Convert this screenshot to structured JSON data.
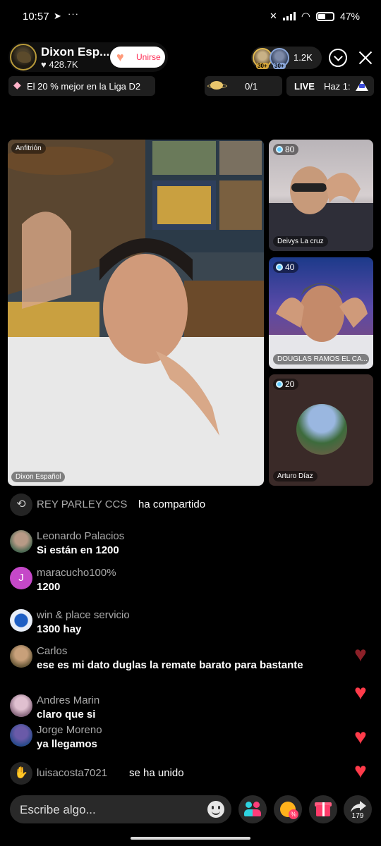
{
  "status_bar": {
    "time": "10:57",
    "telegram_icon": "telegram-icon",
    "more_dots": "···",
    "battery": "47%"
  },
  "host": {
    "name": "Dixon Esp...",
    "likes": "428.7K",
    "join_label": "Unirse"
  },
  "viewers": {
    "badge1": "30+",
    "badge2": "30+",
    "count": "1.2K"
  },
  "rank": {
    "label": "El 20 % mejor en la Liga D2"
  },
  "goal": {
    "progress": "0/1"
  },
  "live": {
    "label": "LIVE",
    "hint": "Haz 1:"
  },
  "videos": {
    "main": {
      "role_tag": "Anfitrión",
      "name": "Dixon Español"
    },
    "guests": [
      {
        "score": "80",
        "name": "Deivys La cruz"
      },
      {
        "score": "40",
        "name": "DOUGLAS RAMOS EL CA..."
      },
      {
        "score": "20",
        "name": "Arturo Díaz"
      }
    ]
  },
  "chat": {
    "share": {
      "user": "REY PARLEY CCS",
      "action": "ha compartido"
    },
    "messages": [
      {
        "user": "Leonardo Palacios",
        "text": "Si están en 1200"
      },
      {
        "user": "maracucho100%",
        "text": "1200",
        "initial": "J"
      },
      {
        "user": "win & place servicio",
        "text": "1300 hay"
      },
      {
        "user": "Carlos",
        "text": "ese es mi dato duglas la remate barato para bastante"
      },
      {
        "user": "Andres Marin",
        "text": "claro que si"
      },
      {
        "user": "Jorge Moreno",
        "text": "ya llegamos"
      }
    ],
    "joined": {
      "user": "luisacosta7021",
      "action": "se ha unido"
    }
  },
  "bottom_bar": {
    "input_placeholder": "Escribe algo...",
    "share_count": "179",
    "promo_badge": "%"
  },
  "colors": {
    "accent": "#fe2c55",
    "heart": "#ff3b4a",
    "score_dot": "#5ec9ff"
  }
}
